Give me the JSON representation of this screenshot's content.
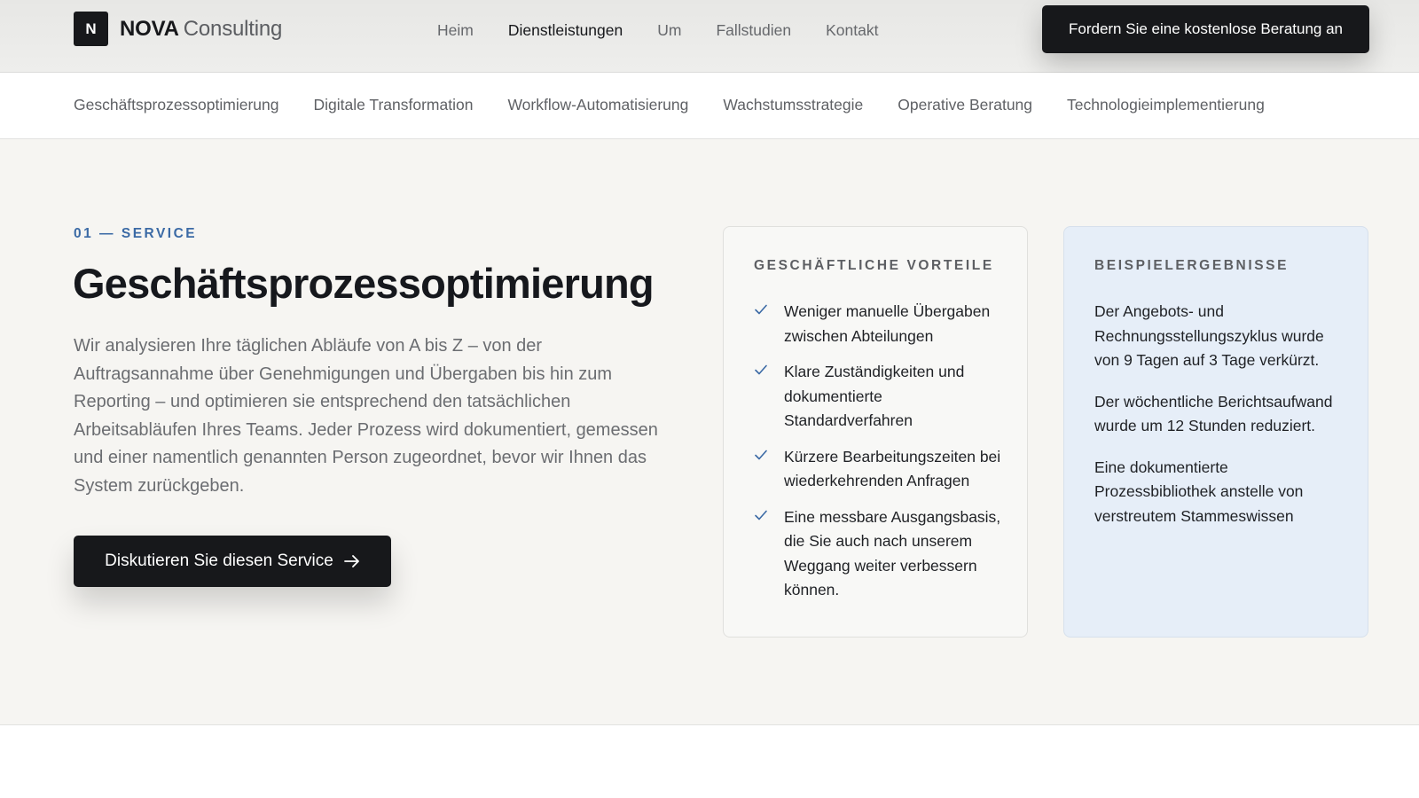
{
  "header": {
    "brand_mark": "N",
    "brand_name": "NOVA",
    "brand_sub": "Consulting",
    "nav": [
      "Heim",
      "Dienstleistungen",
      "Um",
      "Fallstudien",
      "Kontakt"
    ],
    "active_nav": "Dienstleistungen",
    "cta_label": "Fordern Sie eine kostenlose Beratung an"
  },
  "subnav": {
    "items": [
      "Geschäftsprozessoptimierung",
      "Digitale Transformation",
      "Workflow-Automatisierung",
      "Wachstumsstrategie",
      "Operative Beratung",
      "Technologieimplementierung"
    ]
  },
  "service": {
    "eyebrow": "01 — SERVICE",
    "title": "Geschäftsprozessoptimierung",
    "description": "Wir analysieren Ihre täglichen Abläufe von A bis Z – von der Auftragsannahme über Genehmigungen und Übergaben bis hin zum Reporting – und optimieren sie entsprechend den tatsächlichen Arbeitsabläufen Ihres Teams. Jeder Prozess wird dokumentiert, gemessen und einer namentlich genannten Person zugeordnet, bevor wir Ihnen das System zurückgeben.",
    "cta_label": "Diskutieren Sie diesen Service",
    "cta_icon": "arrow-right-icon"
  },
  "benefits": {
    "heading": "GESCHÄFTLICHE VORTEILE",
    "icon": "check-icon",
    "items": [
      "Weniger manuelle Übergaben zwischen Abteilungen",
      "Klare Zuständigkeiten und dokumentierte Standardverfahren",
      "Kürzere Bearbeitungszeiten bei wiederkehrenden Anfragen",
      "Eine messbare Ausgangsbasis, die Sie auch nach unserem Weggang weiter verbessern können."
    ]
  },
  "results": {
    "heading": "BEISPIELERGEBNISSE",
    "items": [
      "Der Angebots- und Rechnungsstellungszyklus wurde von 9 Tagen auf 3 Tage verkürzt.",
      "Der wöchentliche Berichtsaufwand wurde um 12 Stunden reduziert.",
      "Eine dokumentierte Prozessbibliothek anstelle von verstreutem Stammeswissen"
    ]
  },
  "colors": {
    "accent": "#3b6aa5",
    "dark": "#17181b",
    "hero_bg": "#f6f5f2",
    "results_bg": "#e6eef8"
  }
}
